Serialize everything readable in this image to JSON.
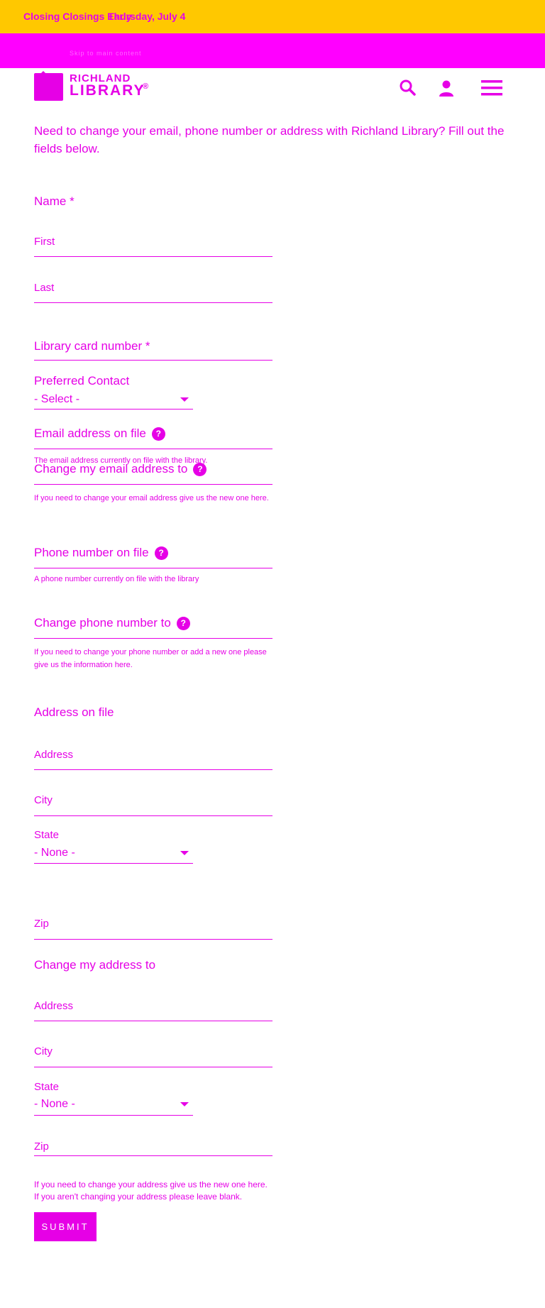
{
  "alert": {
    "overlay_a": "Closing Closings Early",
    "overlay_b": "Thursday, July 4"
  },
  "nav": {
    "skip_text": "Skip to main content"
  },
  "logo": {
    "line1": "RICHLAND",
    "line2": "LIBRARY",
    "mark": "®"
  },
  "header": {
    "search_icon": "search-icon",
    "account_icon": "account-icon",
    "menu_icon": "hamburger-menu-icon"
  },
  "intro": "Need to change your email, phone number or address with Richland Library? Fill out the fields below.",
  "form": {
    "name_label": "Name *",
    "first_label": "First",
    "last_label": "Last",
    "card_label": "Library card number *",
    "contact_label": "Preferred Contact",
    "contact_value": "- Select -",
    "email_label": "Email address on file",
    "email_help": "The email address currently on file with the library.",
    "change_email_label": "Change my email address to",
    "change_email_help": "If you need to change your email address give us the new one here.",
    "phone_label": "Phone number on file",
    "phone_help": "A phone number currently on file with the library",
    "change_phone_label": "Change phone number to",
    "change_phone_help": "If you need to change your phone number or add a new one please give us the information here.",
    "address_label": "Address on file",
    "address_sub": "Address",
    "city_sub": "City",
    "state_sub": "State",
    "state_value": "- None -",
    "zip_sub": "Zip",
    "change_address_label": "Change my address to",
    "change_address_help1": "If you need to change your address give us the new one here.",
    "change_address_help2": "If you aren't changing your address please leave blank.",
    "question_mark": "?",
    "submit_label": "SUBMIT"
  },
  "colors": {
    "accent": "#e600e6",
    "alert_bg": "#ffc800",
    "nav_bg": "#ff00ff"
  }
}
